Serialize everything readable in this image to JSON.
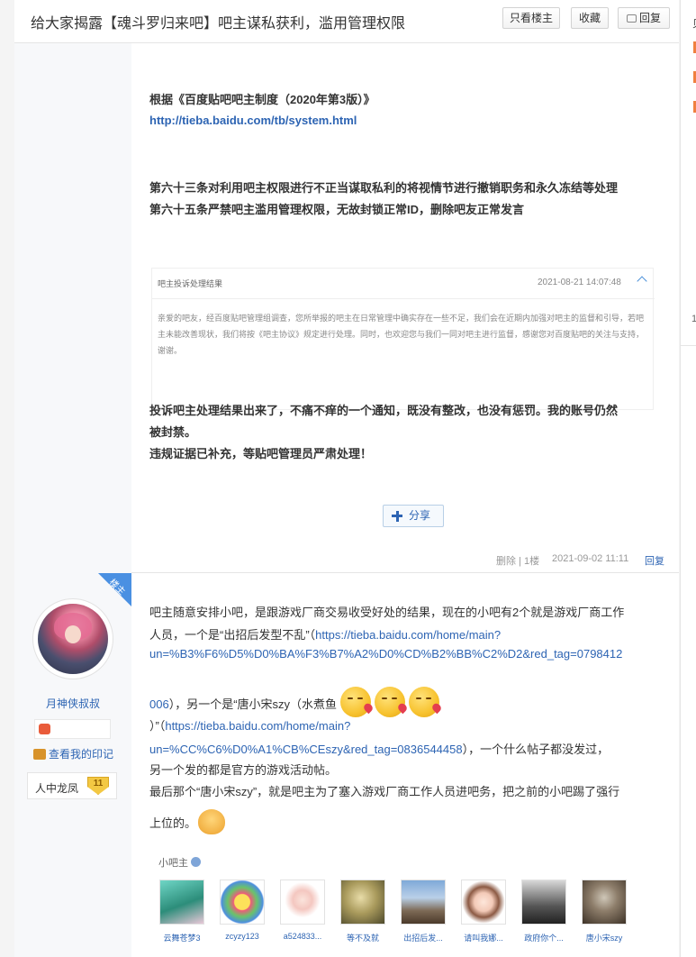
{
  "header": {
    "title": "给大家揭露【魂斗罗归来吧】吧主谋私获利，滥用管理权限",
    "only_op_label": "只看楼主",
    "favorite_label": "收藏",
    "reply_label": "回复"
  },
  "side": {
    "partial_top": "贝",
    "partial_mid": "1"
  },
  "post1": {
    "ref_line": "根据《百度贴吧吧主制度（2020年第3版）》",
    "ref_link": "http://tieba.baidu.com/tb/system.html",
    "rule_63": "第六十三条对利用吧主权限进行不正当谋取私利的将视情节进行撤销职务和永久冻结等处理",
    "rule_65": "第六十五条严禁吧主滥用管理权限，无故封锁正常ID，删除吧友正常发言",
    "notice": {
      "title": "吧主投诉处理结果",
      "date": "2021-08-21 14:07:48",
      "body": "亲爱的吧友，经百度贴吧管理组调查，您所举报的吧主在日常管理中确实存在一些不足，我们会在近期内加强对吧主的监督和引导，若吧主未能改善现状，我们将按《吧主协议》规定进行处理。同时，也欢迎您与我们一同对吧主进行监督，感谢您对百度贴吧的关注与支持，谢谢。"
    },
    "complaint_1": "投诉吧主处理结果出来了，不痛不痒的一个通知，既没有整改，也没有惩罚。我的账号仍然",
    "complaint_2": "被封禁。",
    "complaint_3": "违规证据已补充，等贴吧管理员严肃处理！",
    "share_label": "分享",
    "delete_label": "删除 | 1楼",
    "datetime": "2021-09-02 11:11",
    "reply_label": "回复"
  },
  "post2": {
    "badge": "楼主",
    "author": "月神侠叔叔",
    "my_mark_label": "查看我的印记",
    "level_name": "人中龙凤",
    "level_num": "11",
    "line1": "吧主随意安排小吧，是跟游戏厂商交易收受好处的结果，现在的小吧有2个就是游戏厂商工作",
    "line2a": "人员，一个是“出招后发型不乱”（",
    "link1a": "https://tieba.baidu.com/home/main?",
    "link1b": "un=%B3%F6%D5%D0%BA%F3%B7%A2%D0%CD%B2%BB%C2%D2&red_tag=0798412",
    "link1c": "006",
    "line4b": "），另一个是“唐小宋szy（水煮鱼",
    "line5a": "）”（",
    "link2a": "https://tieba.baidu.com/home/main?",
    "link2b": "un=%CC%C6%D0%A1%CB%CEszy&red_tag=0836544458",
    "line6b": "），一个什么帖子都没发过，",
    "line7": "另一个发的都是官方的游戏活动帖。",
    "line8": "最后那个“唐小宋szy”，就是吧主为了塞入游戏厂商工作人员进吧务，把之前的小吧踢了强行",
    "line9": "上位的。",
    "helpers_title": "小吧主",
    "helpers": [
      {
        "name": "云舞苍梦3"
      },
      {
        "name": "zcyzy123"
      },
      {
        "name": "a524833..."
      },
      {
        "name": "等不及就"
      },
      {
        "name": "出招后发..."
      },
      {
        "name": "请叫我娜..."
      },
      {
        "name": "政府你个..."
      },
      {
        "name": "唐小宋szy"
      }
    ]
  }
}
